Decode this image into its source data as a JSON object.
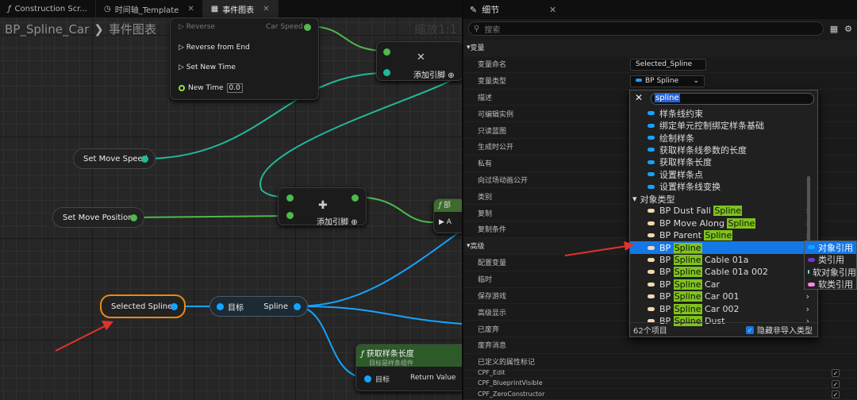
{
  "tabs": [
    {
      "label": "Construction Scr...",
      "icon": "function-icon"
    },
    {
      "label": "时间轴_Template",
      "icon": "clock-icon"
    },
    {
      "label": "事件图表",
      "icon": "graph-icon"
    }
  ],
  "breadcrumb": {
    "blueprint": "BP_Spline_Car",
    "graph": "事件图表"
  },
  "zoom": "缩放1:1",
  "timeline_node": {
    "reverse": "Reverse",
    "reverse_from_end": "Reverse from End",
    "set_new_time": "Set New Time",
    "new_time": "New Time",
    "new_time_value": "0.0",
    "car_speed": "Car Speed"
  },
  "add_pin_nodes": [
    {
      "label": "添加引脚"
    },
    {
      "label": "添加引脚"
    }
  ],
  "variables": {
    "set_move_speed": "Set Move Speed",
    "set_move_position": "Set Move Position",
    "selected_spline": "Selected Spline"
  },
  "get_node": {
    "target": "目标",
    "output": "Spline"
  },
  "length_node": {
    "title": "获取样条长度",
    "subtitle": "目标是样条组件",
    "target": "目标",
    "return_value": "Return Value"
  },
  "partial_node": {
    "title": "部",
    "pin": "A"
  },
  "details": {
    "title": "细节",
    "search_placeholder": "搜索",
    "categories": {
      "variable": "变量",
      "advanced": "高级"
    },
    "rows": [
      "变量命名",
      "变量类型",
      "描述",
      "可编辑实例",
      "只读蓝图",
      "生成时公开",
      "私有",
      "向过场动画公开",
      "类别",
      "复制",
      "复制条件"
    ],
    "advanced_rows": [
      "配置变量",
      "临时",
      "保存游戏",
      "高级显示",
      "已废弃",
      "废弃消息",
      "已定义的属性标记"
    ],
    "var_name": "Selected_Spline",
    "var_type": "BP Spline",
    "flags": [
      "CPF_Edit",
      "CPF_BlueprintVisible",
      "CPF_ZeroConstructor"
    ]
  },
  "dropdown": {
    "search": "spline",
    "functions": [
      "样条线约束",
      "绑定单元控制绑定样条基础",
      "绘制样条",
      "获取样条线参数的长度",
      "获取样条长度",
      "设置样条点",
      "设置样条线变换"
    ],
    "object_types_label": "对象类型",
    "items": [
      {
        "pre": "BP Dust Fall ",
        "hl": "Spline",
        "post": ""
      },
      {
        "pre": "BP Move Along ",
        "hl": "Spline",
        "post": ""
      },
      {
        "pre": "BP Parent ",
        "hl": "Spline",
        "post": ""
      },
      {
        "pre": "BP ",
        "hl": "Spline",
        "post": ""
      },
      {
        "pre": "BP ",
        "hl": "Spline",
        "post": " Cable 01a"
      },
      {
        "pre": "BP ",
        "hl": "Spline",
        "post": " Cable 01a 002"
      },
      {
        "pre": "BP ",
        "hl": "Spline",
        "post": " Car"
      },
      {
        "pre": "BP ",
        "hl": "Spline",
        "post": " Car 001"
      },
      {
        "pre": "BP ",
        "hl": "Spline",
        "post": " Car 002"
      },
      {
        "pre": "BP ",
        "hl": "Spline",
        "post": " Dust"
      }
    ],
    "count": "62个项目",
    "hide_unloaded": "隐藏非导入类型"
  },
  "submenu": [
    {
      "label": "对象引用",
      "color": "#15a3ff"
    },
    {
      "label": "类引用",
      "color": "#7d2fd6"
    },
    {
      "label": "软对象引用",
      "color": "#6fe0e0"
    },
    {
      "label": "软类引用",
      "color": "#ff85e8"
    }
  ],
  "colors": {
    "exec_pin": "#ffffff",
    "bool_pin": "#4fb84f",
    "object_pin": "#15a3ff",
    "selection": "#1477e6",
    "highlight": "#7fc31c",
    "annotation": "#e0332b"
  }
}
